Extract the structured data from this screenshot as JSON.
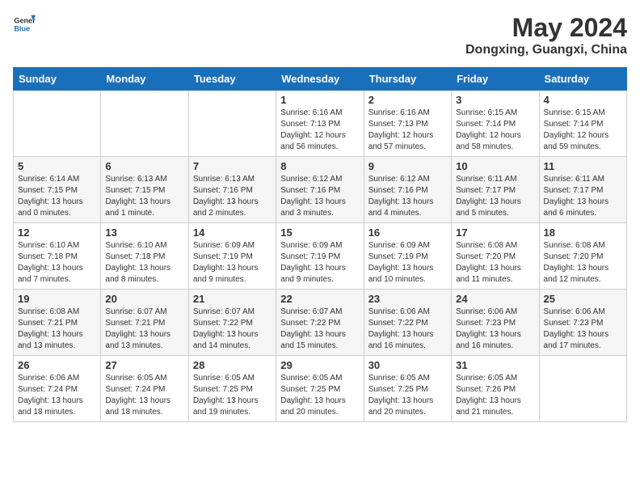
{
  "header": {
    "logo_general": "General",
    "logo_blue": "Blue",
    "month_year": "May 2024",
    "location": "Dongxing, Guangxi, China"
  },
  "days_of_week": [
    "Sunday",
    "Monday",
    "Tuesday",
    "Wednesday",
    "Thursday",
    "Friday",
    "Saturday"
  ],
  "weeks": [
    [
      {
        "day": "",
        "info": ""
      },
      {
        "day": "",
        "info": ""
      },
      {
        "day": "",
        "info": ""
      },
      {
        "day": "1",
        "info": "Sunrise: 6:16 AM\nSunset: 7:13 PM\nDaylight: 12 hours and 56 minutes."
      },
      {
        "day": "2",
        "info": "Sunrise: 6:16 AM\nSunset: 7:13 PM\nDaylight: 12 hours and 57 minutes."
      },
      {
        "day": "3",
        "info": "Sunrise: 6:15 AM\nSunset: 7:14 PM\nDaylight: 12 hours and 58 minutes."
      },
      {
        "day": "4",
        "info": "Sunrise: 6:15 AM\nSunset: 7:14 PM\nDaylight: 12 hours and 59 minutes."
      }
    ],
    [
      {
        "day": "5",
        "info": "Sunrise: 6:14 AM\nSunset: 7:15 PM\nDaylight: 13 hours and 0 minutes."
      },
      {
        "day": "6",
        "info": "Sunrise: 6:13 AM\nSunset: 7:15 PM\nDaylight: 13 hours and 1 minute."
      },
      {
        "day": "7",
        "info": "Sunrise: 6:13 AM\nSunset: 7:16 PM\nDaylight: 13 hours and 2 minutes."
      },
      {
        "day": "8",
        "info": "Sunrise: 6:12 AM\nSunset: 7:16 PM\nDaylight: 13 hours and 3 minutes."
      },
      {
        "day": "9",
        "info": "Sunrise: 6:12 AM\nSunset: 7:16 PM\nDaylight: 13 hours and 4 minutes."
      },
      {
        "day": "10",
        "info": "Sunrise: 6:11 AM\nSunset: 7:17 PM\nDaylight: 13 hours and 5 minutes."
      },
      {
        "day": "11",
        "info": "Sunrise: 6:11 AM\nSunset: 7:17 PM\nDaylight: 13 hours and 6 minutes."
      }
    ],
    [
      {
        "day": "12",
        "info": "Sunrise: 6:10 AM\nSunset: 7:18 PM\nDaylight: 13 hours and 7 minutes."
      },
      {
        "day": "13",
        "info": "Sunrise: 6:10 AM\nSunset: 7:18 PM\nDaylight: 13 hours and 8 minutes."
      },
      {
        "day": "14",
        "info": "Sunrise: 6:09 AM\nSunset: 7:19 PM\nDaylight: 13 hours and 9 minutes."
      },
      {
        "day": "15",
        "info": "Sunrise: 6:09 AM\nSunset: 7:19 PM\nDaylight: 13 hours and 9 minutes."
      },
      {
        "day": "16",
        "info": "Sunrise: 6:09 AM\nSunset: 7:19 PM\nDaylight: 13 hours and 10 minutes."
      },
      {
        "day": "17",
        "info": "Sunrise: 6:08 AM\nSunset: 7:20 PM\nDaylight: 13 hours and 11 minutes."
      },
      {
        "day": "18",
        "info": "Sunrise: 6:08 AM\nSunset: 7:20 PM\nDaylight: 13 hours and 12 minutes."
      }
    ],
    [
      {
        "day": "19",
        "info": "Sunrise: 6:08 AM\nSunset: 7:21 PM\nDaylight: 13 hours and 13 minutes."
      },
      {
        "day": "20",
        "info": "Sunrise: 6:07 AM\nSunset: 7:21 PM\nDaylight: 13 hours and 13 minutes."
      },
      {
        "day": "21",
        "info": "Sunrise: 6:07 AM\nSunset: 7:22 PM\nDaylight: 13 hours and 14 minutes."
      },
      {
        "day": "22",
        "info": "Sunrise: 6:07 AM\nSunset: 7:22 PM\nDaylight: 13 hours and 15 minutes."
      },
      {
        "day": "23",
        "info": "Sunrise: 6:06 AM\nSunset: 7:22 PM\nDaylight: 13 hours and 16 minutes."
      },
      {
        "day": "24",
        "info": "Sunrise: 6:06 AM\nSunset: 7:23 PM\nDaylight: 13 hours and 16 minutes."
      },
      {
        "day": "25",
        "info": "Sunrise: 6:06 AM\nSunset: 7:23 PM\nDaylight: 13 hours and 17 minutes."
      }
    ],
    [
      {
        "day": "26",
        "info": "Sunrise: 6:06 AM\nSunset: 7:24 PM\nDaylight: 13 hours and 18 minutes."
      },
      {
        "day": "27",
        "info": "Sunrise: 6:05 AM\nSunset: 7:24 PM\nDaylight: 13 hours and 18 minutes."
      },
      {
        "day": "28",
        "info": "Sunrise: 6:05 AM\nSunset: 7:25 PM\nDaylight: 13 hours and 19 minutes."
      },
      {
        "day": "29",
        "info": "Sunrise: 6:05 AM\nSunset: 7:25 PM\nDaylight: 13 hours and 20 minutes."
      },
      {
        "day": "30",
        "info": "Sunrise: 6:05 AM\nSunset: 7:25 PM\nDaylight: 13 hours and 20 minutes."
      },
      {
        "day": "31",
        "info": "Sunrise: 6:05 AM\nSunset: 7:26 PM\nDaylight: 13 hours and 21 minutes."
      },
      {
        "day": "",
        "info": ""
      }
    ]
  ]
}
